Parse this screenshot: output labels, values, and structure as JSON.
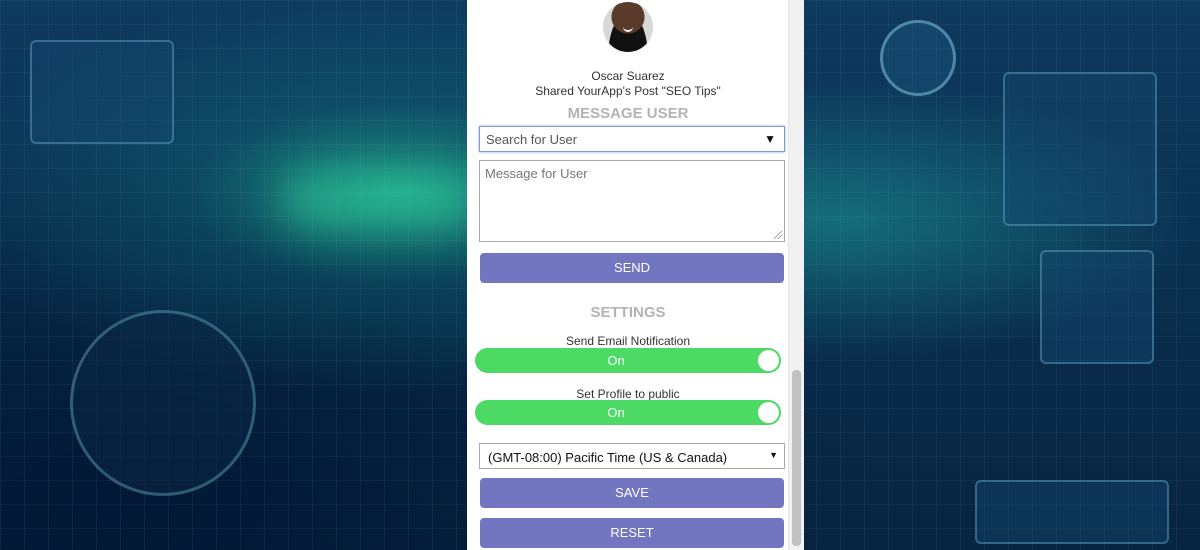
{
  "profile": {
    "avatar_icon": "user-avatar",
    "name": "Oscar Suarez",
    "activity": "Shared YourApp's Post \"SEO Tips\""
  },
  "message_section": {
    "title": "MESSAGE USER",
    "search_placeholder": "Search for User",
    "message_placeholder": "Message for User",
    "send_label": "SEND"
  },
  "settings_section": {
    "title": "SETTINGS",
    "email_notification": {
      "label": "Send Email Notification",
      "state": "On"
    },
    "public_profile": {
      "label": "Set Profile to public",
      "state": "On"
    },
    "timezone": "(GMT-08:00) Pacific Time (US & Canada)",
    "save_label": "SAVE",
    "reset_label": "RESET"
  },
  "colors": {
    "button": "#7275bf",
    "toggle_on": "#4cd964",
    "section_title": "#b3b3b3"
  }
}
